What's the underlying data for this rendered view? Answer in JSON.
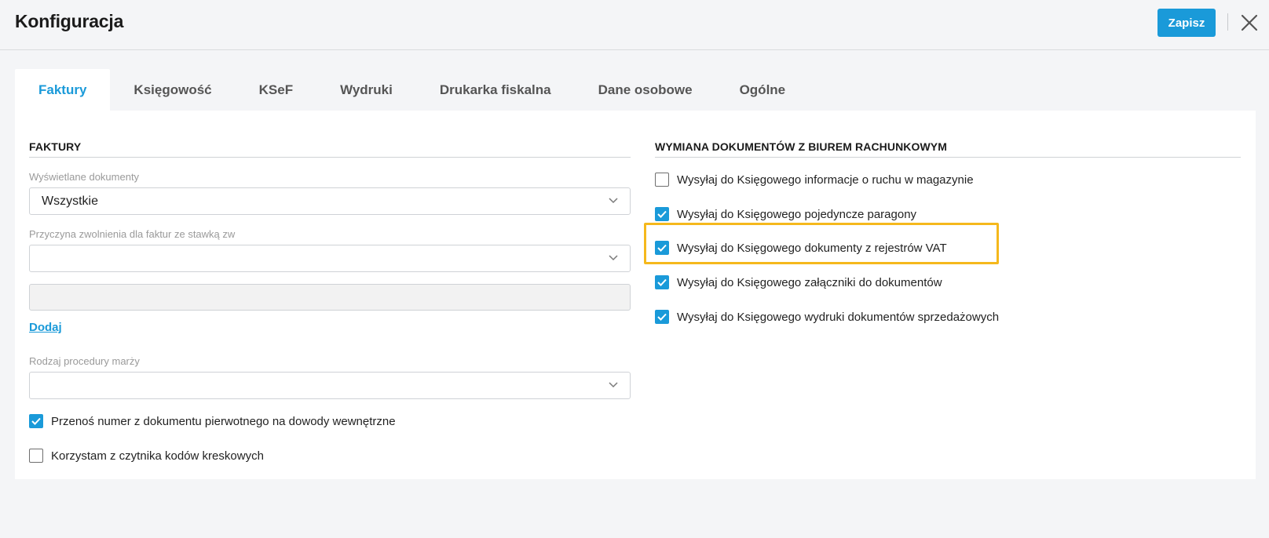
{
  "header": {
    "title": "Konfiguracja",
    "save_label": "Zapisz"
  },
  "tabs": [
    {
      "label": "Faktury",
      "active": true
    },
    {
      "label": "Księgowość"
    },
    {
      "label": "KSeF"
    },
    {
      "label": "Wydruki"
    },
    {
      "label": "Drukarka fiskalna"
    },
    {
      "label": "Dane osobowe"
    },
    {
      "label": "Ogólne"
    }
  ],
  "left": {
    "section_title": "FAKTURY",
    "displayed_docs": {
      "label": "Wyświetlane dokumenty",
      "value": "Wszystkie"
    },
    "exemption_reason": {
      "label": "Przyczyna zwolnienia dla faktur ze stawką zw",
      "value": ""
    },
    "add_link": "Dodaj",
    "margin_procedure": {
      "label": "Rodzaj procedury marży",
      "value": ""
    },
    "checkboxes": [
      {
        "label": "Przenoś numer z dokumentu pierwotnego na dowody wewnętrzne",
        "checked": true
      },
      {
        "label": "Korzystam z czytnika kodów kreskowych",
        "checked": false
      }
    ]
  },
  "right": {
    "section_title": "WYMIANA DOKUMENTÓW Z BIUREM RACHUNKOWYM",
    "checkboxes": [
      {
        "label": "Wysyłaj do Księgowego informacje o ruchu w magazynie",
        "checked": false
      },
      {
        "label": "Wysyłaj do Księgowego pojedyncze paragony",
        "checked": true
      },
      {
        "label": "Wysyłaj do Księgowego dokumenty z rejestrów VAT",
        "checked": true
      },
      {
        "label": "Wysyłaj do Księgowego załączniki do dokumentów",
        "checked": true
      },
      {
        "label": "Wysyłaj do Księgowego wydruki dokumentów sprzedażowych",
        "checked": true
      }
    ]
  },
  "colors": {
    "accent": "#1a9ad9",
    "highlight": "#f5b81c"
  }
}
